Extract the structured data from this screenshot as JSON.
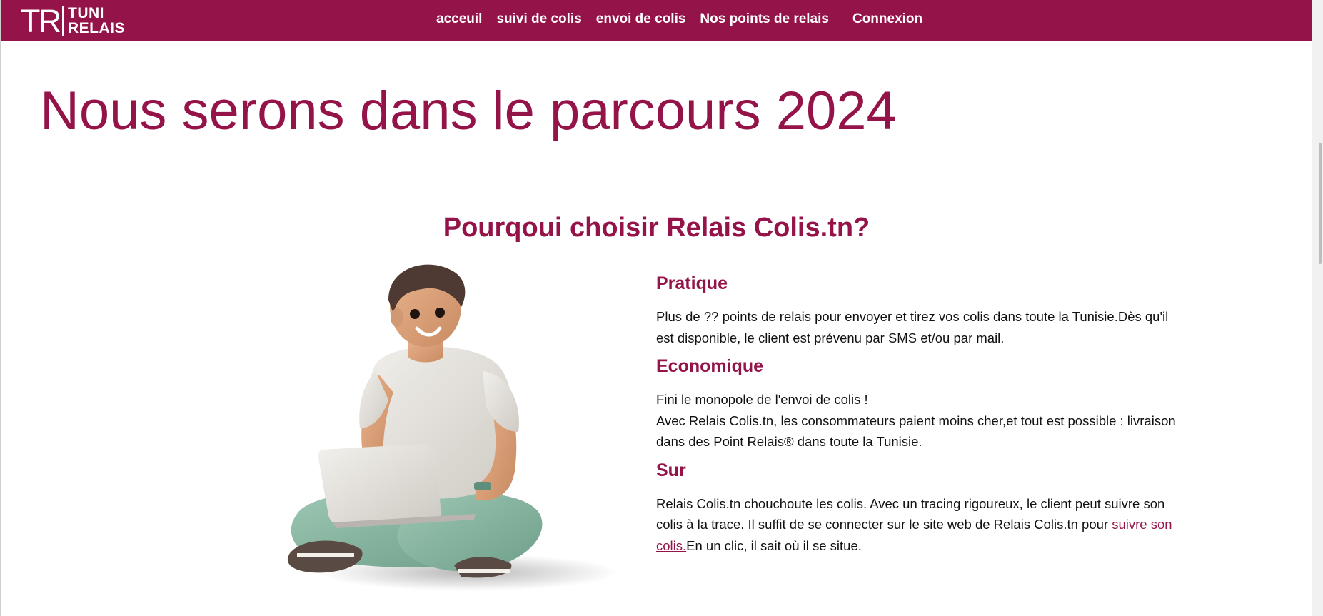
{
  "brand": {
    "mark": "TR",
    "line1": "TUNI",
    "line2": "RELAIS"
  },
  "nav": {
    "items": [
      "acceuil",
      "suivi de colis",
      "envoi de colis",
      "Nos points de relais"
    ],
    "login": "Connexion"
  },
  "hero": {
    "title": "Nous serons dans le parcours 2024"
  },
  "section": {
    "title": "Pourqoui choisir Relais Colis.tn?",
    "features": [
      {
        "title": "Pratique",
        "text": "Plus de ?? points de relais pour envoyer et tirez vos colis dans toute la Tunisie.Dès qu'il est disponible, le client est prévenu par SMS et/ou par mail."
      },
      {
        "title": "Economique",
        "line1": "Fini le monopole de l'envoi de colis !",
        "line2": "Avec Relais Colis.tn, les consommateurs paient moins cher,et tout est possible : livraison dans des Point Relais® dans toute la Tunisie."
      },
      {
        "title": "Sur",
        "text_before": "Relais Colis.tn chouchoute les colis. Avec un tracing rigoureux, le client peut suivre son colis à la trace. Il suffit de se connecter sur le site web de Relais Colis.tn pour ",
        "link": "suivre son colis.",
        "text_after": "En un clic, il sait où il se situe."
      }
    ]
  },
  "colors": {
    "brand": "#941449",
    "text": "#111111",
    "background": "#ffffff"
  },
  "illustration": {
    "icon": "person-with-laptop-illustration"
  }
}
